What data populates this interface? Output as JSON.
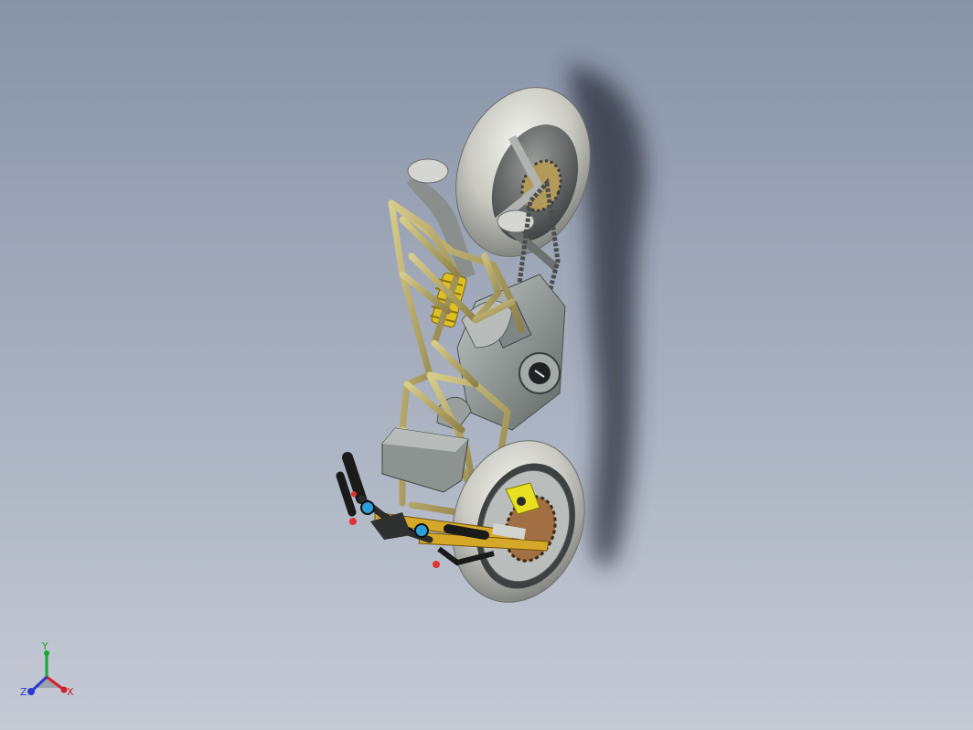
{
  "viewport": {
    "background_top": "#8893a8",
    "background_bottom": "#c5cad5"
  },
  "model": {
    "icon": "motorcycle-chassis-3d-model",
    "colors": {
      "frame": "#b7a862",
      "tire": "#c9c9c2",
      "shock": "#e0c020",
      "caliper": "#e6e020",
      "engine": "#8e9696",
      "shadow": "#2a2f3a",
      "accent": "#2a9fd8",
      "grip": "#1a1a1a"
    }
  },
  "triad": {
    "icon": "coordinate-axis-triad-icon",
    "labels": {
      "x": "X",
      "y": "Y",
      "z": "Z"
    },
    "colors": {
      "x": "#d0202a",
      "y": "#18a82a",
      "z": "#2a3ad0"
    }
  }
}
